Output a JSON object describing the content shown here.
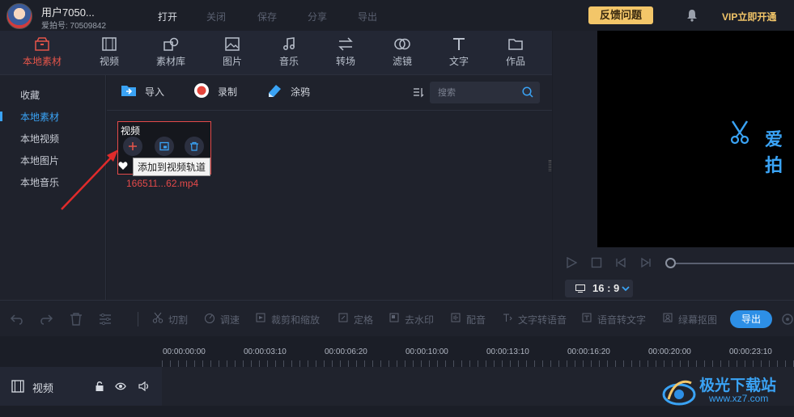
{
  "header": {
    "user_name": "用户7050...",
    "user_id": "爱拍号: 70509842",
    "menu": [
      "打开",
      "关闭",
      "保存",
      "分享",
      "导出"
    ],
    "feedback": "反馈问题",
    "vip": "VIP立即开通"
  },
  "toolbar": {
    "tabs": [
      "本地素材",
      "视频",
      "素材库",
      "图片",
      "音乐",
      "转场",
      "滤镜",
      "文字",
      "作品"
    ],
    "active_index": 0
  },
  "sidebar": {
    "items": [
      "收藏",
      "本地素材",
      "本地视频",
      "本地图片",
      "本地音乐"
    ],
    "active_index": 1
  },
  "media_bar": {
    "import": "导入",
    "record": "录制",
    "graffiti": "涂鸦",
    "search_placeholder": "搜索"
  },
  "clip": {
    "type": "视频",
    "tooltip": "添加到视频轨道",
    "filename": "166511...62.mp4"
  },
  "preview": {
    "brand": "爱拍",
    "aspect_ratio": "16 : 9"
  },
  "edit_toolbar": {
    "tools": [
      "切割",
      "调速",
      "裁剪和缩放",
      "定格",
      "去水印",
      "配音",
      "文字转语音",
      "语音转文字",
      "绿幕抠图"
    ],
    "export": "导出"
  },
  "timeline": {
    "ticks": [
      "00:00:00:00",
      "00:00:03:10",
      "00:00:06:20",
      "00:00:10:00",
      "00:00:13:10",
      "00:00:16:20",
      "00:00:20:00",
      "00:00:23:10"
    ],
    "track_name": "视频"
  },
  "watermark": {
    "title": "极光下载站",
    "url": "www.xz7.com"
  },
  "colors": {
    "accent": "#3aa3f5",
    "active_red": "#e5554a",
    "gold": "#f3c669",
    "export_blue": "#2d8fe6"
  }
}
